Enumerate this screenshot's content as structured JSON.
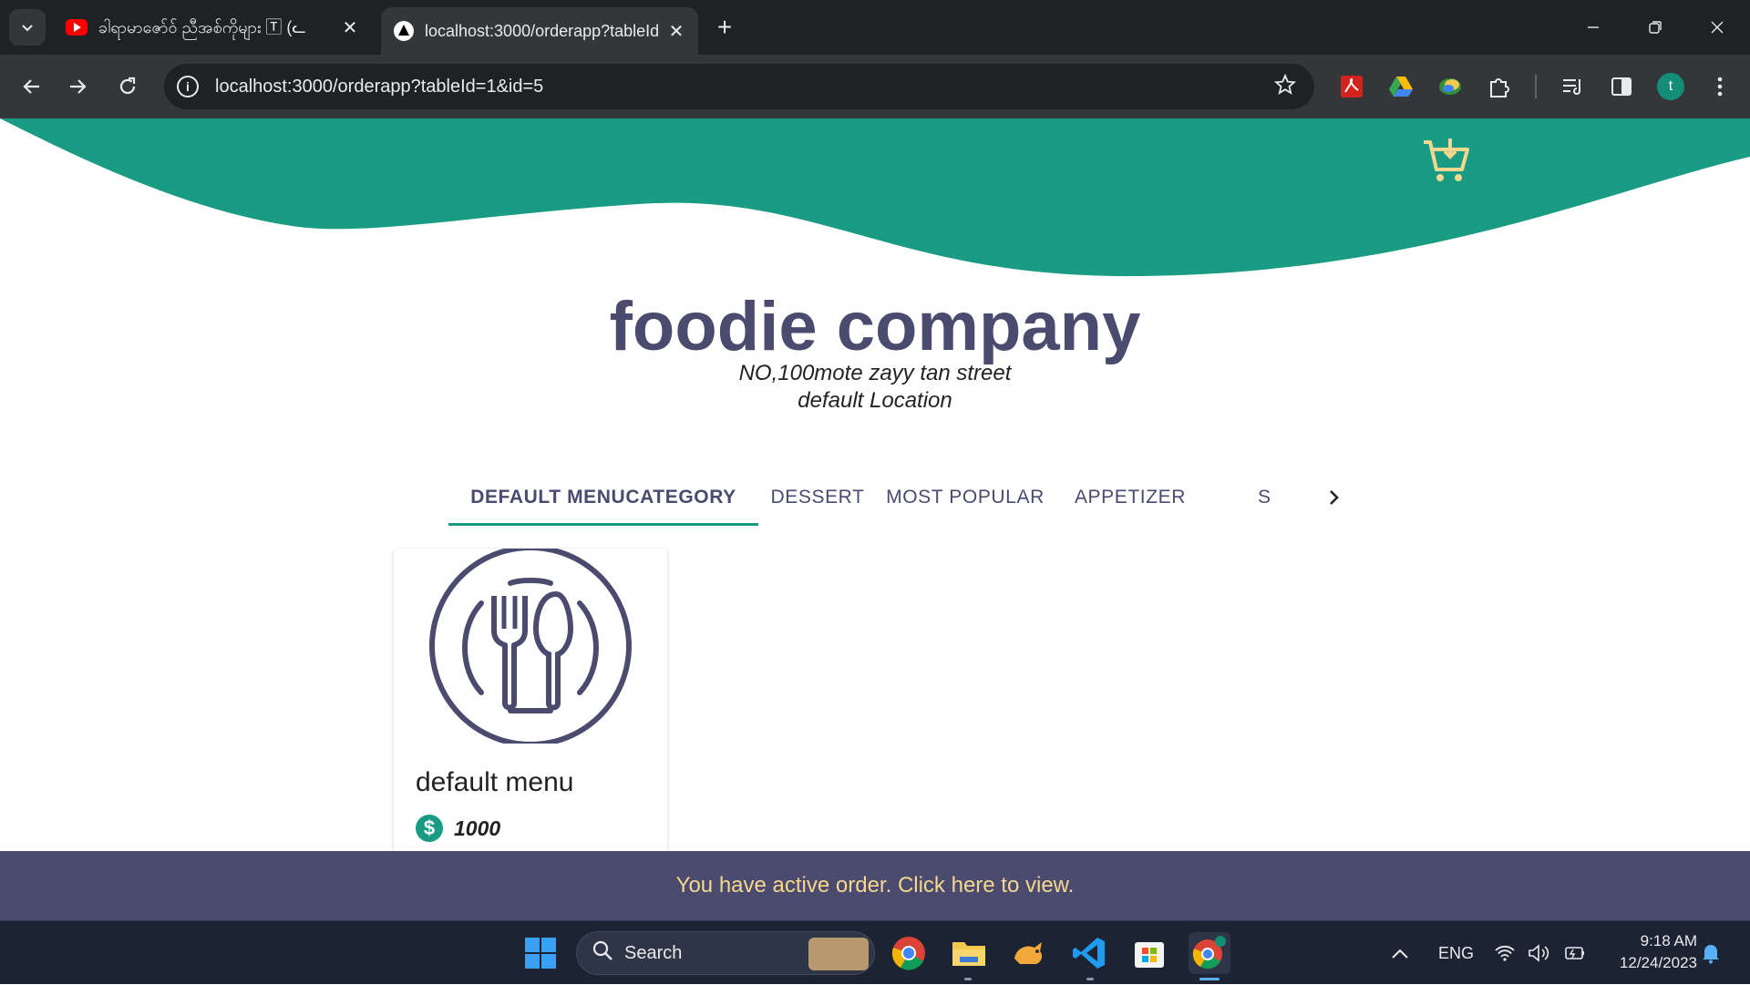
{
  "browser": {
    "tabs": [
      {
        "title": "ခါရာမာဇော်ဝ် ညီအစ်ကိုများ 🅃 (ᓚ",
        "favicon": "youtube-icon",
        "active": false
      },
      {
        "title": "localhost:3000/orderapp?tableId",
        "favicon": "nextjs-icon",
        "active": true
      }
    ],
    "new_tab": "+",
    "url": "localhost:3000/orderapp?tableId=1&id=5",
    "avatar_letter": "t",
    "window_controls": {
      "minimize": "—",
      "restore": "❐",
      "close": "✕"
    }
  },
  "page": {
    "company_name": "foodie company",
    "address_line1": "NO,100mote zayy tan street",
    "address_line2": "default Location",
    "menu_tabs": [
      {
        "label": "DEFAULT MENUCATEGORY",
        "active": true
      },
      {
        "label": "DESSERT",
        "active": false
      },
      {
        "label": "MOST POPULAR",
        "active": false
      },
      {
        "label": "APPETIZER",
        "active": false
      },
      {
        "label": "S",
        "active": false
      }
    ],
    "menu_items": [
      {
        "name": "default menu",
        "price": "1000",
        "currency_symbol": "$"
      }
    ],
    "banner_text": "You have active order. Click here to view.",
    "colors": {
      "primary": "#1a9b84",
      "dark": "#4a4b6e",
      "banner_text": "#f5d78e"
    }
  },
  "taskbar": {
    "search_placeholder": "Search",
    "language": "ENG",
    "time": "9:18 AM",
    "date": "12/24/2023",
    "pinned": [
      "windows-start-icon",
      "chrome-icon",
      "file-explorer-icon",
      "pet-app-icon",
      "vscode-icon",
      "microsoft-store-icon",
      "chrome-profile-icon"
    ]
  }
}
